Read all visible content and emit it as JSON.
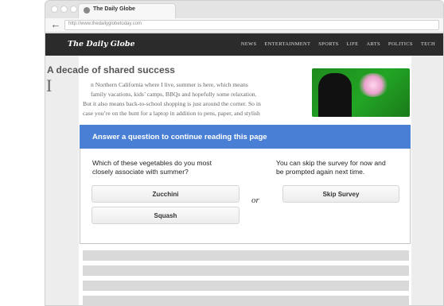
{
  "browser": {
    "tab_title": "The Daily Globe",
    "url": "http://www.thedailyglobetoday.com"
  },
  "site": {
    "logo": "The Daily Globe",
    "nav": [
      "NEWS",
      "ENTERTAINMENT",
      "SPORTS",
      "LIFE",
      "ARTS",
      "POLITICS",
      "TECH"
    ]
  },
  "article": {
    "headline": "A decade of shared success",
    "dropcap": "I",
    "lines": [
      "n Northern California where I live, summer is here, which means",
      "family vacations, kids’ camps, BBQs and hopefully some relaxation.",
      "But it also means back-to-school shopping is just around the corner. So in",
      "case you’re on the hunt for a laptop in addition to pens, paper, and stylish"
    ]
  },
  "survey": {
    "title": "Answer a question to continue reading this page",
    "question_lines": [
      "Which of these vegetables do you most",
      "closely associate with summer?"
    ],
    "answers": [
      "Zucchini",
      "Squash"
    ],
    "or_label": "or",
    "skip_lines": [
      "You can skip the survey for now and",
      "be prompted again next time."
    ],
    "skip_label": "Skip Survey"
  },
  "colors": {
    "header_bg": "#2b2b2b",
    "survey_accent": "#4a7fd6"
  }
}
